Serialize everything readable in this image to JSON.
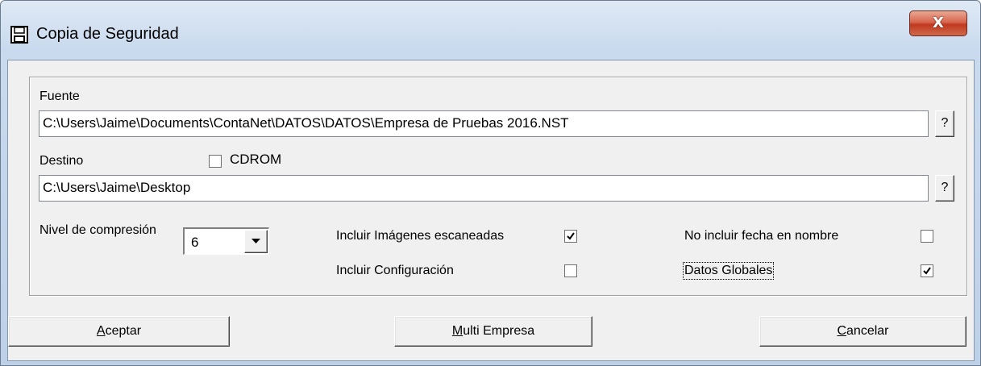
{
  "window": {
    "title": "Copia de Seguridad",
    "close_label": "X"
  },
  "source": {
    "label": "Fuente",
    "value": "C:\\Users\\Jaime\\Documents\\ContaNet\\DATOS\\DATOS\\Empresa de Pruebas 2016.NST",
    "browse_label": "?"
  },
  "destination": {
    "label": "Destino",
    "cdrom_label": "CDROM",
    "cdrom_checked": false,
    "value": "C:\\Users\\Jaime\\Desktop",
    "browse_label": "?"
  },
  "compression": {
    "label": "Nivel de compresión",
    "selected": "6"
  },
  "options": {
    "include_scanned_images": {
      "label": "Incluir Imágenes escaneadas",
      "checked": true
    },
    "include_configuration": {
      "label": "Incluir Configuración",
      "checked": false
    },
    "no_date_in_name": {
      "label": "No incluir fecha en nombre",
      "checked": false
    },
    "global_data": {
      "label": "Datos Globales",
      "checked": true
    }
  },
  "buttons": {
    "accept": {
      "mnemonic": "A",
      "rest": "ceptar"
    },
    "multi": {
      "mnemonic": "M",
      "rest": "ulti Empresa"
    },
    "cancel": {
      "mnemonic": "C",
      "rest": "ancelar"
    }
  },
  "icons": {
    "title": "floppy-disk-icon",
    "close": "close-icon",
    "dropdown": "chevron-down-icon",
    "check": "checkmark-icon"
  }
}
